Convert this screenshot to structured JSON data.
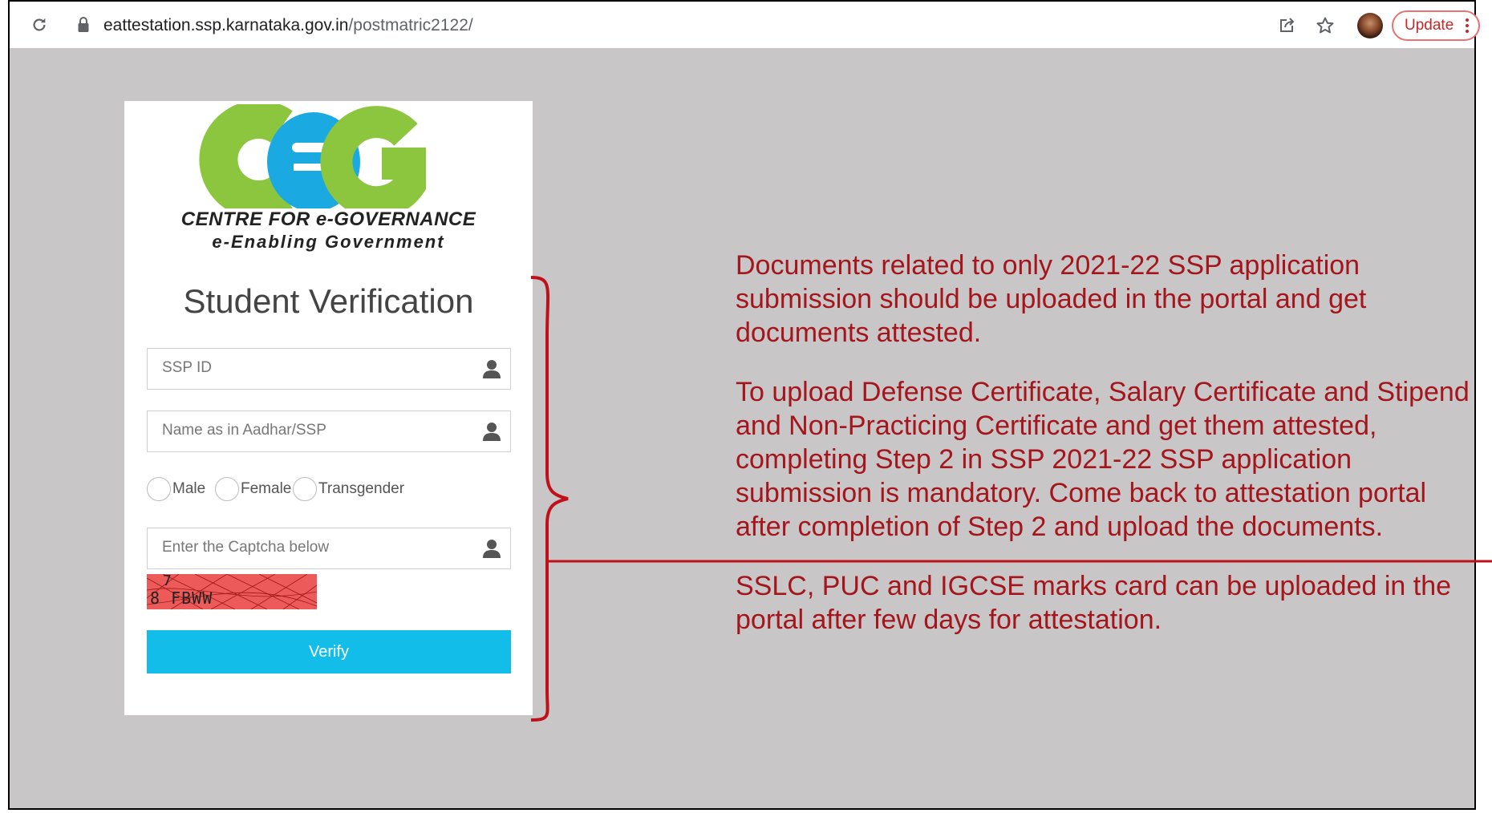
{
  "browser": {
    "url_host": "eattestation.ssp.karnataka.gov.in",
    "url_path": "/postmatric2122/",
    "update_label": "Update"
  },
  "card": {
    "logo_letters": "ceG",
    "logo_line1": "CENTRE FOR e-GOVERNANCE",
    "logo_line2": "e-Enabling Government",
    "title": "Student Verification",
    "ssp_id_placeholder": "SSP ID",
    "name_placeholder": "Name as in Aadhar/SSP",
    "gender_options": [
      "Male",
      "Female",
      "Transgender"
    ],
    "captcha_placeholder": "Enter the Captcha below",
    "captcha_text_top": "7",
    "captcha_text": "8 FBWW",
    "verify_label": "Verify"
  },
  "notes": [
    "Documents related to only 2021-22 SSP application submission should be uploaded in the portal and get documents attested.",
    "To upload Defense Certificate, Salary Certificate and Stipend and Non-Practicing Certificate and get them attested, completing Step 2 in SSP 2021-22 SSP application submission is mandatory. Come back to attestation portal after completion of Step 2 and upload the documents.",
    "SSLC, PUC and IGCSE marks card can be uploaded in the portal after few days for attestation."
  ],
  "colors": {
    "accent": "#12bde9",
    "note_text": "#a4151c",
    "logo_green": "#8cc63f",
    "logo_blue": "#1ba9e1",
    "background": "#c8c6c7"
  },
  "icons": [
    "reload-icon",
    "lock-icon",
    "share-icon",
    "star-icon",
    "user-icon",
    "more-vert-icon"
  ]
}
